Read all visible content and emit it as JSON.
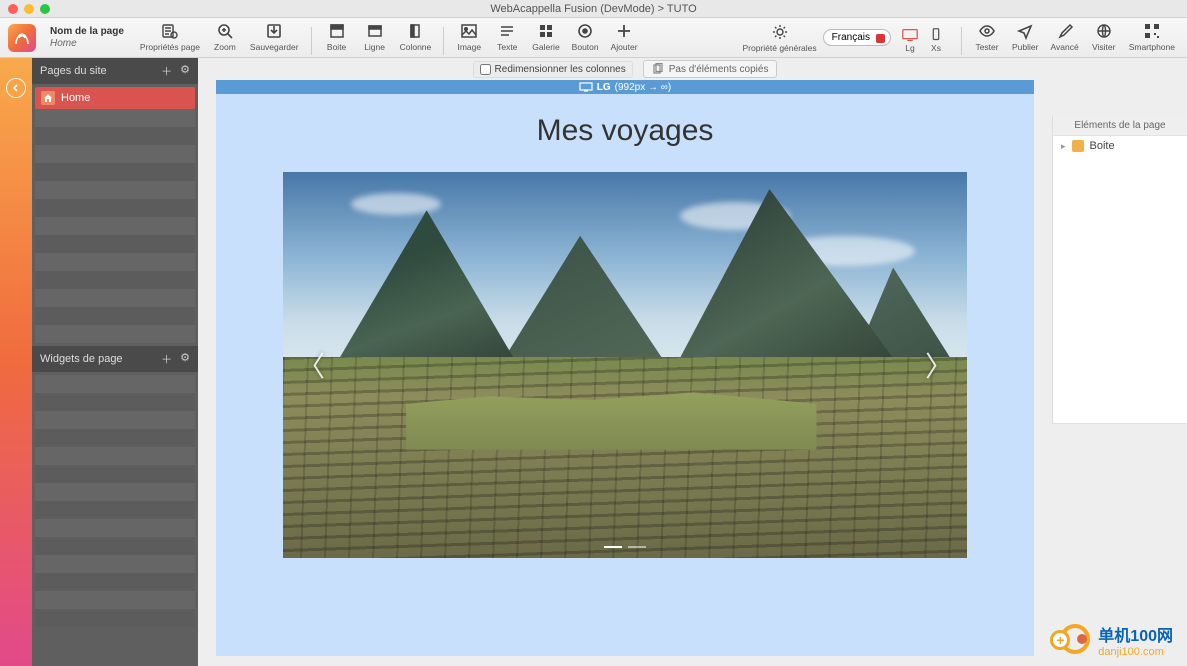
{
  "window": {
    "title": "WebAcappella Fusion (DevMode) > TUTO"
  },
  "header": {
    "page_name_label": "Nom de la page",
    "page_name_value": "Home",
    "language": "Français",
    "tools": {
      "properties": "Propriétés page",
      "zoom": "Zoom",
      "save": "Sauvegarder",
      "box": "Boite",
      "line": "Ligne",
      "column": "Colonne",
      "image": "Image",
      "text": "Texte",
      "gallery": "Galerie",
      "button": "Bouton",
      "add": "Ajouter",
      "general_props": "Propriété générales",
      "lg": "Lg",
      "xs": "Xs",
      "test": "Tester",
      "publish": "Publier",
      "advanced": "Avancé",
      "visit": "Visiter",
      "smartphone": "Smartphone"
    }
  },
  "canvas": {
    "resize_label": "Redimensionner les colonnes",
    "clipboard_label": "Pas d'éléments copiés",
    "breakpoint_label": "LG",
    "breakpoint_range": "(992px → ∞)",
    "page_title": "Mes voyages"
  },
  "left": {
    "pages_header": "Pages du site",
    "widgets_header": "Widgets de page",
    "page_item": "Home"
  },
  "right": {
    "header": "Eléments de la page",
    "item": "Boite"
  },
  "watermark": {
    "line1": "单机100网",
    "line2": "danji100.com"
  }
}
